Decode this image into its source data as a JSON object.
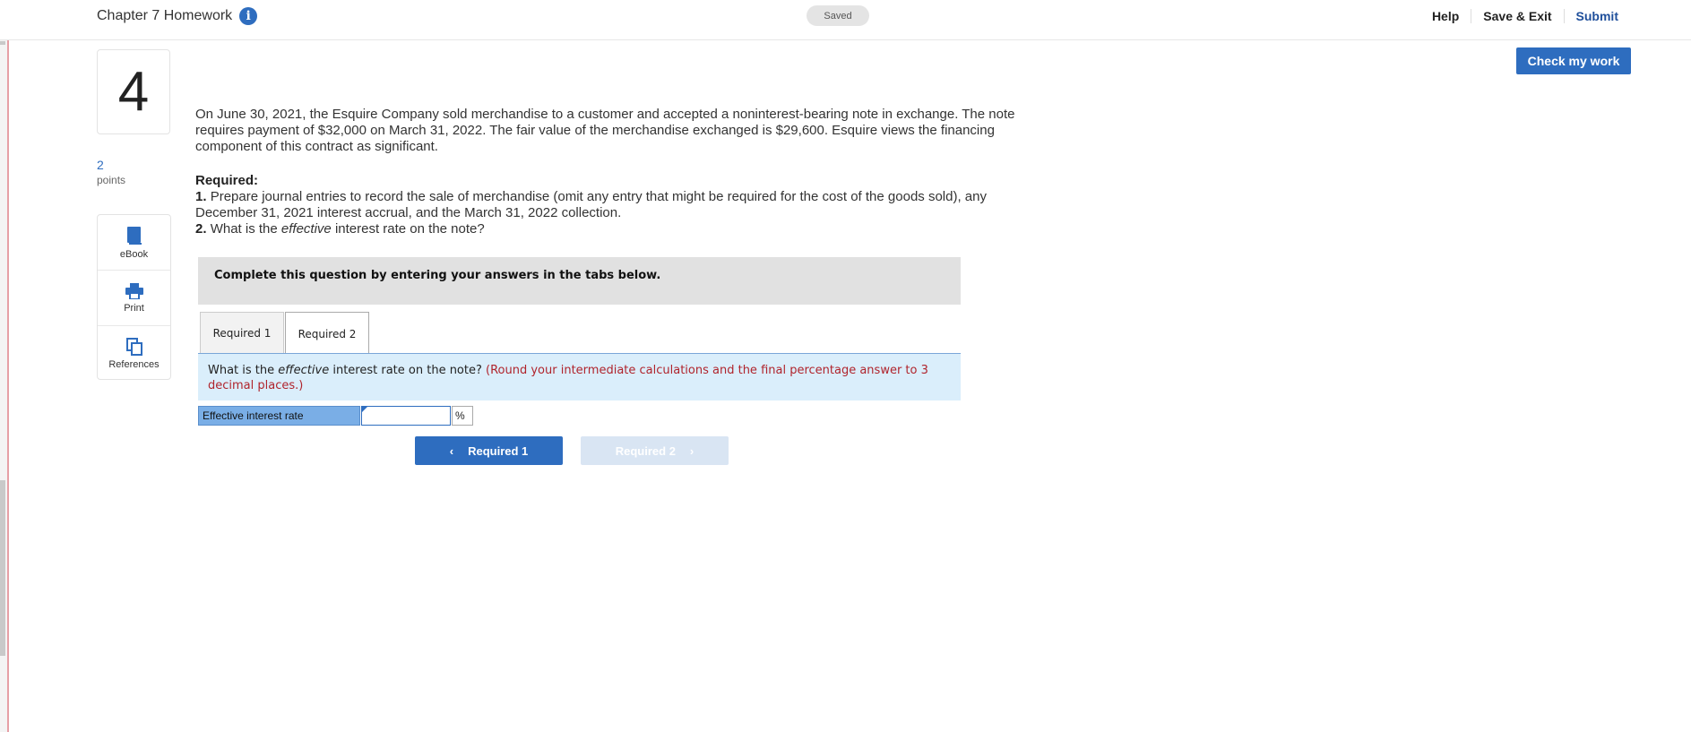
{
  "header": {
    "title": "Chapter 7 Homework",
    "saved_label": "Saved",
    "help_label": "Help",
    "save_exit_label": "Save & Exit",
    "submit_label": "Submit",
    "check_label": "Check my work"
  },
  "question": {
    "number": "4",
    "points_value": "2",
    "points_label": "points",
    "intro": "On June 30, 2021, the Esquire Company sold merchandise to a customer and accepted a noninterest-bearing note in exchange. The note requires payment of $32,000 on March 31, 2022. The fair value of the merchandise exchanged is $29,600. Esquire views the financing component of this contract as significant.",
    "required_heading": "Required:",
    "req1_num": "1.",
    "req1_text": "Prepare journal entries to record the sale of merchandise (omit any entry that might be required for the cost of the goods sold), any December 31, 2021 interest accrual, and the March 31, 2022 collection.",
    "req2_num": "2.",
    "req2_pre": "What is the",
    "req2_em": "effective",
    "req2_post": "interest rate on the note?"
  },
  "tools": {
    "ebook": "eBook",
    "print": "Print",
    "references": "References"
  },
  "instructions": "Complete this question by entering your answers in the tabs below.",
  "tabs": [
    {
      "label": "Required 1"
    },
    {
      "label": "Required 2"
    }
  ],
  "prompt": {
    "pre": "What is the",
    "em": "effective",
    "post": "interest rate on the note?",
    "hint": "(Round your intermediate calculations and the final percentage answer to 3 decimal places.)"
  },
  "answer": {
    "label": "Effective interest rate",
    "value": "",
    "unit": "%"
  },
  "nav": {
    "prev_label": "Required 1",
    "next_label": "Required 2"
  }
}
